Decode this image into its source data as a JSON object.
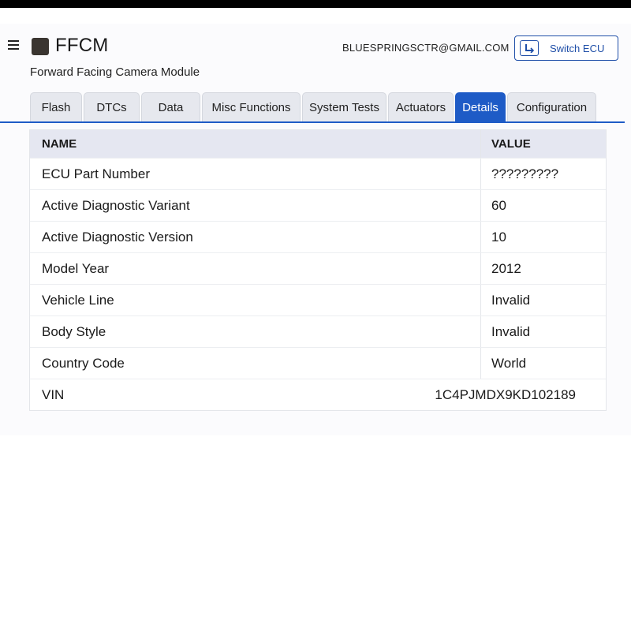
{
  "app": {
    "title": "FFCM",
    "subtitle": "Forward Facing Camera Module",
    "user_email": "BLUESPRINGSCTR@GMAIL.COM",
    "switch_ecu_label": "Switch ECU",
    "accent_color": "#1e5bc6"
  },
  "tabs": [
    {
      "label": "Flash",
      "active": false
    },
    {
      "label": "DTCs",
      "active": false
    },
    {
      "label": "Data",
      "active": false
    },
    {
      "label": "Misc Functions",
      "active": false
    },
    {
      "label": "System Tests",
      "active": false
    },
    {
      "label": "Actuators",
      "active": false
    },
    {
      "label": "Details",
      "active": true
    },
    {
      "label": "Configuration",
      "active": false
    }
  ],
  "table": {
    "headers": {
      "name": "NAME",
      "value": "VALUE"
    },
    "rows": [
      {
        "name": "ECU Part Number",
        "value": "?????????"
      },
      {
        "name": "Active Diagnostic Variant",
        "value": "60"
      },
      {
        "name": "Active Diagnostic Version",
        "value": "10"
      },
      {
        "name": "Model Year",
        "value": "2012"
      },
      {
        "name": "Vehicle Line",
        "value": "Invalid"
      },
      {
        "name": "Body Style",
        "value": "Invalid"
      },
      {
        "name": "Country Code",
        "value": "World"
      },
      {
        "name": "VIN",
        "value": "1C4PJMDX9KD102189"
      }
    ]
  }
}
